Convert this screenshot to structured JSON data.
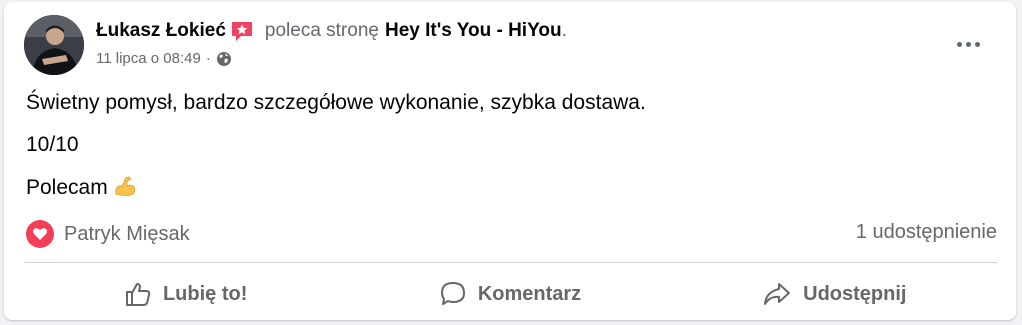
{
  "post": {
    "author": "Łukasz Łokieć",
    "action_text": "poleca stronę",
    "page_name": "Hey It's You - HiYou",
    "page_name_suffix": ".",
    "timestamp": "11 lipca o 08:49",
    "separator": "·",
    "privacy_icon": "globe-icon",
    "body_lines": [
      "Świetny pomysł, bardzo szczegółowe wykonanie, szybka dostawa.",
      "10/10",
      "Polecam"
    ],
    "emoji": "flexed-biceps-icon"
  },
  "reactions": {
    "icon": "heart-icon",
    "names": "Patryk Mięsak",
    "shares": "1 udostępnienie"
  },
  "actions": {
    "like_label": "Lubię to!",
    "comment_label": "Komentarz",
    "share_label": "Udostępnij"
  },
  "colors": {
    "text_primary": "#050505",
    "text_secondary": "#65676b",
    "heart": "#f33e58",
    "badge": "#f3425f"
  }
}
